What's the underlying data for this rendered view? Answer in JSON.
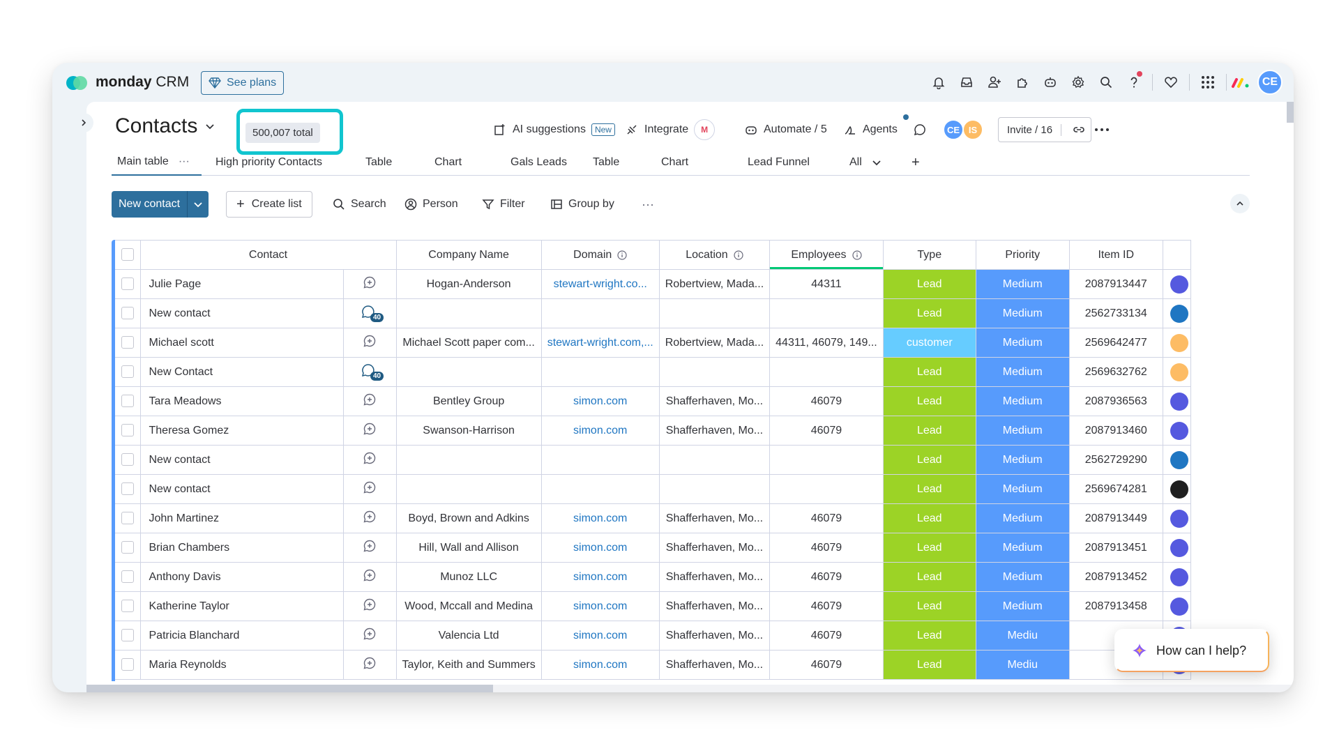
{
  "app": {
    "brand": "monday",
    "brand_suffix": "CRM",
    "see_plans": "See plans",
    "avatar": "CE"
  },
  "board": {
    "title": "Contacts",
    "total": "500,007 total"
  },
  "header_actions": {
    "ai_suggestions": "AI suggestions",
    "new_tag": "New",
    "integrate": "Integrate",
    "gmail": "M",
    "automate": "Automate / 5",
    "agents": "Agents",
    "members": [
      "CE",
      "IS"
    ],
    "invite": "Invite / 16"
  },
  "tabs": [
    "Main table",
    "High priority Contacts",
    "Table",
    "Chart",
    "Gals Leads",
    "Table",
    "Chart",
    "Lead Funnel",
    "All"
  ],
  "tabs_more": "···",
  "toolbar": {
    "new_contact": "New contact",
    "create_list": "Create list",
    "search": "Search",
    "person": "Person",
    "filter": "Filter",
    "group_by": "Group by",
    "more": "···"
  },
  "columns": [
    "Contact",
    "Company Name",
    "Domain",
    "Location",
    "Employees",
    "Type",
    "Priority",
    "Item ID"
  ],
  "colors": {
    "lead": "#9cd326",
    "customer": "#66ccff",
    "medium": "#579bfc",
    "accent": "#2d6f9d",
    "highlight": "#11c5cf"
  },
  "rows": [
    {
      "contact": "Julie Page",
      "updates": "",
      "company": "Hogan-Anderson",
      "domain": "stewart-wright.co...",
      "location": "Robertview, Mada...",
      "employees": "44311",
      "type": "Lead",
      "priority": "Medium",
      "id": "2087913447",
      "avatar_color": "#5559df"
    },
    {
      "contact": "New contact",
      "updates": "40",
      "company": "",
      "domain": "",
      "location": "",
      "employees": "",
      "type": "Lead",
      "priority": "Medium",
      "id": "2562733134",
      "avatar_color": "#1f76c2"
    },
    {
      "contact": "Michael scott",
      "updates": "",
      "company": "Michael Scott paper com...",
      "domain": "stewart-wright.com,...",
      "location": "Robertview, Mada...",
      "employees": "44311, 46079, 149...",
      "type": "customer",
      "priority": "Medium",
      "id": "2569642477",
      "avatar_color": "#fdbc64"
    },
    {
      "contact": "New Contact",
      "updates": "40",
      "company": "",
      "domain": "",
      "location": "",
      "employees": "",
      "type": "Lead",
      "priority": "Medium",
      "id": "2569632762",
      "avatar_color": "#fdbc64"
    },
    {
      "contact": "Tara Meadows",
      "updates": "",
      "company": "Bentley Group",
      "domain": "simon.com",
      "location": "Shafferhaven, Mo...",
      "employees": "46079",
      "type": "Lead",
      "priority": "Medium",
      "id": "2087936563",
      "avatar_color": "#5559df"
    },
    {
      "contact": "Theresa Gomez",
      "updates": "",
      "company": "Swanson-Harrison",
      "domain": "simon.com",
      "location": "Shafferhaven, Mo...",
      "employees": "46079",
      "type": "Lead",
      "priority": "Medium",
      "id": "2087913460",
      "avatar_color": "#5559df"
    },
    {
      "contact": "New contact",
      "updates": "",
      "company": "",
      "domain": "",
      "location": "",
      "employees": "",
      "type": "Lead",
      "priority": "Medium",
      "id": "2562729290",
      "avatar_color": "#1f76c2"
    },
    {
      "contact": "New contact",
      "updates": "",
      "company": "",
      "domain": "",
      "location": "",
      "employees": "",
      "type": "Lead",
      "priority": "Medium",
      "id": "2569674281",
      "avatar_color": "#1f1f1f"
    },
    {
      "contact": "John Martinez",
      "updates": "",
      "company": "Boyd, Brown and Adkins",
      "domain": "simon.com",
      "location": "Shafferhaven, Mo...",
      "employees": "46079",
      "type": "Lead",
      "priority": "Medium",
      "id": "2087913449",
      "avatar_color": "#5559df"
    },
    {
      "contact": "Brian Chambers",
      "updates": "",
      "company": "Hill, Wall and Allison",
      "domain": "simon.com",
      "location": "Shafferhaven, Mo...",
      "employees": "46079",
      "type": "Lead",
      "priority": "Medium",
      "id": "2087913451",
      "avatar_color": "#5559df"
    },
    {
      "contact": "Anthony Davis",
      "updates": "",
      "company": "Munoz LLC",
      "domain": "simon.com",
      "location": "Shafferhaven, Mo...",
      "employees": "46079",
      "type": "Lead",
      "priority": "Medium",
      "id": "2087913452",
      "avatar_color": "#5559df"
    },
    {
      "contact": "Katherine Taylor",
      "updates": "",
      "company": "Wood, Mccall and Medina",
      "domain": "simon.com",
      "location": "Shafferhaven, Mo...",
      "employees": "46079",
      "type": "Lead",
      "priority": "Medium",
      "id": "2087913458",
      "avatar_color": "#5559df"
    },
    {
      "contact": "Patricia Blanchard",
      "updates": "",
      "company": "Valencia Ltd",
      "domain": "simon.com",
      "location": "Shafferhaven, Mo...",
      "employees": "46079",
      "type": "Lead",
      "priority": "Mediu",
      "id": "",
      "avatar_color": "#5559df"
    },
    {
      "contact": "Maria Reynolds",
      "updates": "",
      "company": "Taylor, Keith and Summers",
      "domain": "simon.com",
      "location": "Shafferhaven, Mo...",
      "employees": "46079",
      "type": "Lead",
      "priority": "Mediu",
      "id": "",
      "avatar_color": "#5559df"
    }
  ],
  "assistant": {
    "label": "How can I help?"
  }
}
